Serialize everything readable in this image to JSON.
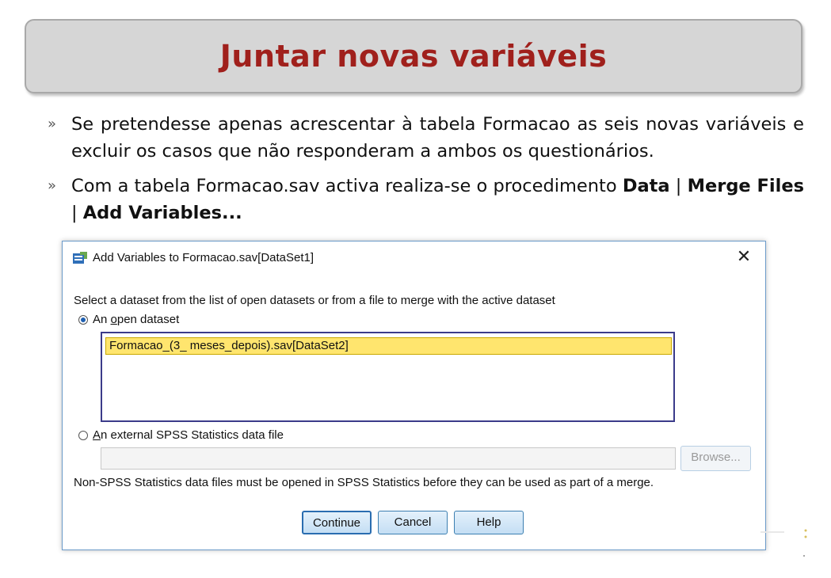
{
  "slide": {
    "title": "Juntar novas variáveis",
    "bullet_marker": "»",
    "bullet1": "Se pretendesse apenas acrescentar à tabela Formacao as seis novas variáveis e excluir os casos que não responderam a ambos os questionários.",
    "bullet2_text": "Com a tabela Formacao.sav activa realiza-se o procedimento ",
    "bullet2_menu_1": "Data",
    "bullet2_sep_1": " | ",
    "bullet2_menu_2": "Merge Files",
    "bullet2_sep_2": " | ",
    "bullet2_menu_3": "Add Variables..."
  },
  "dialog": {
    "title": "Add Variables to Formacao.sav[DataSet1]",
    "close_glyph": "✕",
    "instruction": "Select a dataset from the list of open datasets or from a file to merge with the active dataset",
    "radio_open_prefix": "An ",
    "radio_open_mnemonic": "o",
    "radio_open_suffix": "pen dataset",
    "open_datasets": [
      "Formacao_(3_ meses_depois).sav[DataSet2]"
    ],
    "radio_external_mnemonic": "A",
    "radio_external_suffix": "n external SPSS Statistics data file",
    "file_path_value": "",
    "browse_label": "Browse...",
    "note": "Non-SPSS Statistics data files must be opened in SPSS Statistics before they can be used as part of a merge.",
    "continue_label": "Continue",
    "cancel_label": "Cancel",
    "help_label": "Help",
    "open_dataset_selected": true
  },
  "colors": {
    "title_red": "#a0201c",
    "title_box_bg": "#d6d6d6",
    "selection_yellow": "#ffe56e",
    "button_border": "#3c7fb1"
  }
}
